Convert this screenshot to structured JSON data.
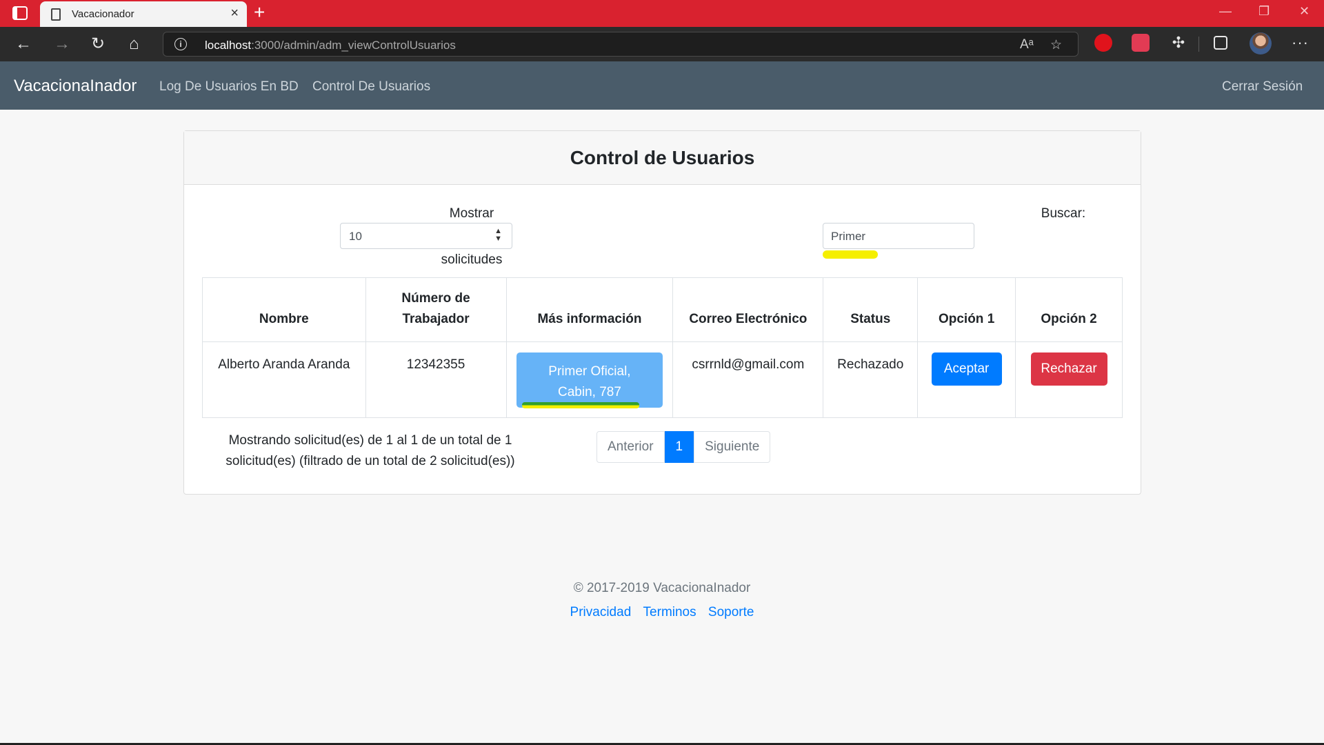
{
  "browser": {
    "tab_title": "Vacacionador",
    "url_host": "localhost",
    "url_path": ":3000/admin/adm_viewControlUsuarios",
    "accent": "#d9222f"
  },
  "navbar": {
    "brand": "VacacionaInador",
    "links": [
      "Log De Usuarios En BD",
      "Control De Usuarios"
    ],
    "logout": "Cerrar Sesión"
  },
  "card": {
    "title": "Control de Usuarios",
    "length": {
      "label": "Mostrar",
      "value": "10",
      "suffix": "solicitudes"
    },
    "search": {
      "label": "Buscar:",
      "value": "Primer"
    },
    "columns": [
      "Nombre",
      "Número de Trabajador",
      "Más información",
      "Correo Electrónico",
      "Status",
      "Opción 1",
      "Opción 2"
    ],
    "rows": [
      {
        "nombre": "Alberto Aranda Aranda",
        "numero": "12342355",
        "info": "Primer Oficial, Cabin, 787",
        "correo": "csrrnld@gmail.com",
        "status": "Rechazado",
        "opcion1": "Aceptar",
        "opcion2": "Rechazar"
      }
    ],
    "info_text": "Mostrando solicitud(es) de 1 al 1 de un total de 1 solicitud(es) (filtrado de un total de 2 solicitud(es))",
    "pagination": {
      "prev": "Anterior",
      "current": "1",
      "next": "Siguiente"
    }
  },
  "footer": {
    "copyright": "© 2017-2019 VacacionaInador",
    "links": [
      "Privacidad",
      "Terminos",
      "Soporte"
    ]
  }
}
